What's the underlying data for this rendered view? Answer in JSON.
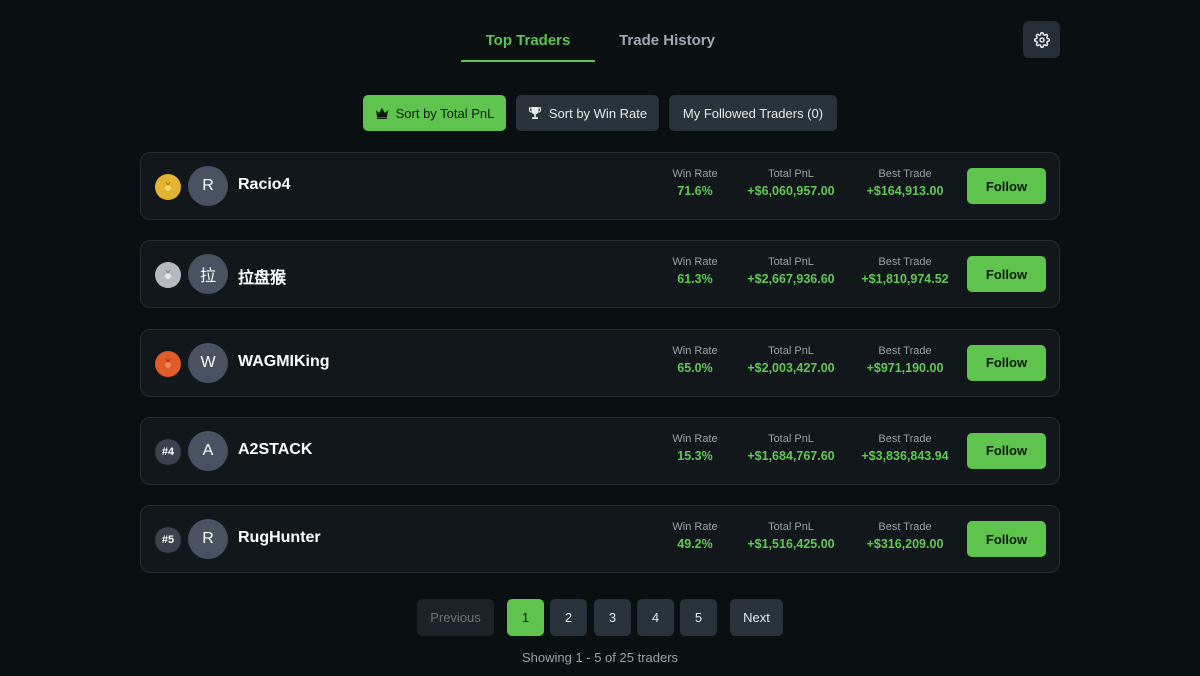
{
  "tabs": {
    "top_traders": "Top Traders",
    "trade_history": "Trade History"
  },
  "settings": {
    "icon": "gear-icon"
  },
  "sort": {
    "by_pnl": "Sort by Total PnL",
    "by_win_rate": "Sort by Win Rate",
    "followed": "My Followed Traders (0)",
    "active": "by_pnl"
  },
  "labels": {
    "win_rate": "Win Rate",
    "total_pnl": "Total PnL",
    "best_trade": "Best Trade",
    "follow": "Follow"
  },
  "traders": [
    {
      "rank_icon": "gold-medal-icon",
      "rank_color": "#e3b334",
      "avatar_initial": "R",
      "name": "Racio4",
      "win_rate": "71.6%",
      "total_pnl": "+$6,060,957.00",
      "best_trade": "+$164,913.00"
    },
    {
      "rank_icon": "silver-medal-icon",
      "rank_color": "#b7bac0",
      "avatar_initial": "拉",
      "name": "拉盘猴",
      "win_rate": "61.3%",
      "total_pnl": "+$2,667,936.60",
      "best_trade": "+$1,810,974.52"
    },
    {
      "rank_icon": "bronze-medal-icon",
      "rank_color": "#e05c2a",
      "avatar_initial": "W",
      "name": "WAGMIKing",
      "win_rate": "65.0%",
      "total_pnl": "+$2,003,427.00",
      "best_trade": "+$971,190.00"
    },
    {
      "rank": "#4",
      "avatar_initial": "A",
      "name": "A2STACK",
      "win_rate": "15.3%",
      "total_pnl": "+$1,684,767.60",
      "best_trade": "+$3,836,843.94"
    },
    {
      "rank": "#5",
      "avatar_initial": "R",
      "name": "RugHunter",
      "win_rate": "49.2%",
      "total_pnl": "+$1,516,425.00",
      "best_trade": "+$316,209.00"
    }
  ],
  "pagination": {
    "previous": "Previous",
    "next": "Next",
    "pages": [
      "1",
      "2",
      "3",
      "4",
      "5"
    ],
    "current_page": 1,
    "summary": "Showing 1 - 5 of 25 traders"
  },
  "colors": {
    "accent": "#5fc44e",
    "background": "#0a0f12",
    "card": "#11171b"
  }
}
